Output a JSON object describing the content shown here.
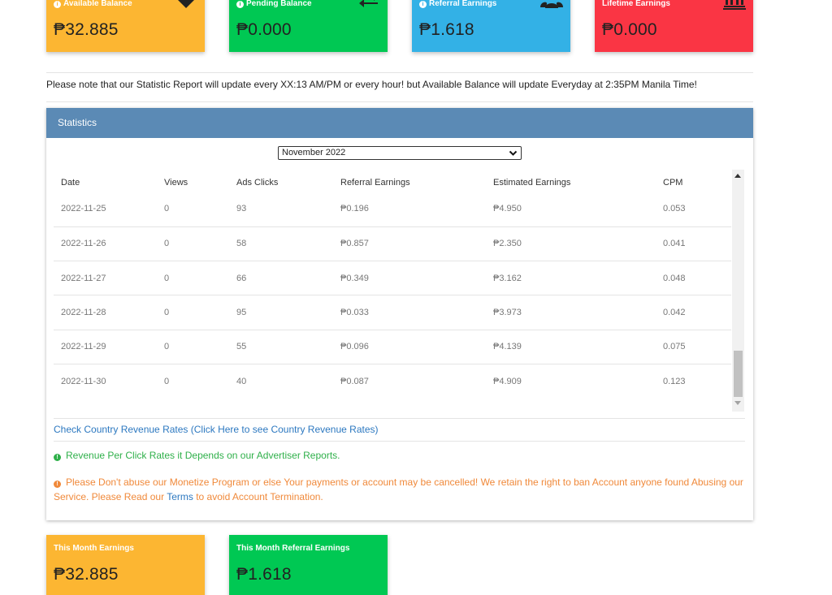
{
  "top_cards": [
    {
      "label": "Available Balance",
      "value": "₱32.885",
      "icon": "heart-icon",
      "color": "#fcb632"
    },
    {
      "label": "Pending Balance",
      "value": "₱0.000",
      "icon": "exchange-arrows-icon",
      "color": "#00c853"
    },
    {
      "label": "Referral Earnings",
      "value": "₱1.618",
      "icon": "users-icon",
      "color": "#33b1e6"
    },
    {
      "label": "Lifetime Earnings",
      "value": "₱0.000",
      "icon": "bank-icon",
      "color": "#fa3544"
    }
  ],
  "notice": "Please note that our Statistic Report will update every XX:13 AM/PM or every hour! but Available Balance will update Everyday at 2:35PM Manila Time!",
  "statistics": {
    "title": "Statistics",
    "selected_month": "November 2022",
    "columns": [
      "Date",
      "Views",
      "Ads Clicks",
      "Referral Earnings",
      "Estimated Earnings",
      "CPM"
    ],
    "rows": [
      [
        "2022-11-25",
        "0",
        "93",
        "₱0.196",
        "₱4.950",
        "0.053"
      ],
      [
        "2022-11-26",
        "0",
        "58",
        "₱0.857",
        "₱2.350",
        "0.041"
      ],
      [
        "2022-11-27",
        "0",
        "66",
        "₱0.349",
        "₱3.162",
        "0.048"
      ],
      [
        "2022-11-28",
        "0",
        "95",
        "₱0.033",
        "₱3.973",
        "0.042"
      ],
      [
        "2022-11-29",
        "0",
        "55",
        "₱0.096",
        "₱4.139",
        "0.075"
      ],
      [
        "2022-11-30",
        "0",
        "40",
        "₱0.087",
        "₱4.909",
        "0.123"
      ]
    ],
    "country_rates_link": "Check Country Revenue Rates (Click Here to see Country Revenue Rates)",
    "rate_note": "Revenue Per Click Rates it Depends on our Advertiser Reports.",
    "warning_before": "Please Don't abuse our Monetize Program or else Your payments or account may be cancelled! We retain the right to ban Account anyone found Abusing our Service. Please Read our ",
    "warning_link": "Terms",
    "warning_after": " to avoid Account Termination."
  },
  "bottom_cards": [
    {
      "label": "This Month Earnings",
      "value": "₱32.885",
      "color": "#fcb632"
    },
    {
      "label": "This Month Referral Earnings",
      "value": "₱1.618",
      "color": "#00c853"
    }
  ]
}
